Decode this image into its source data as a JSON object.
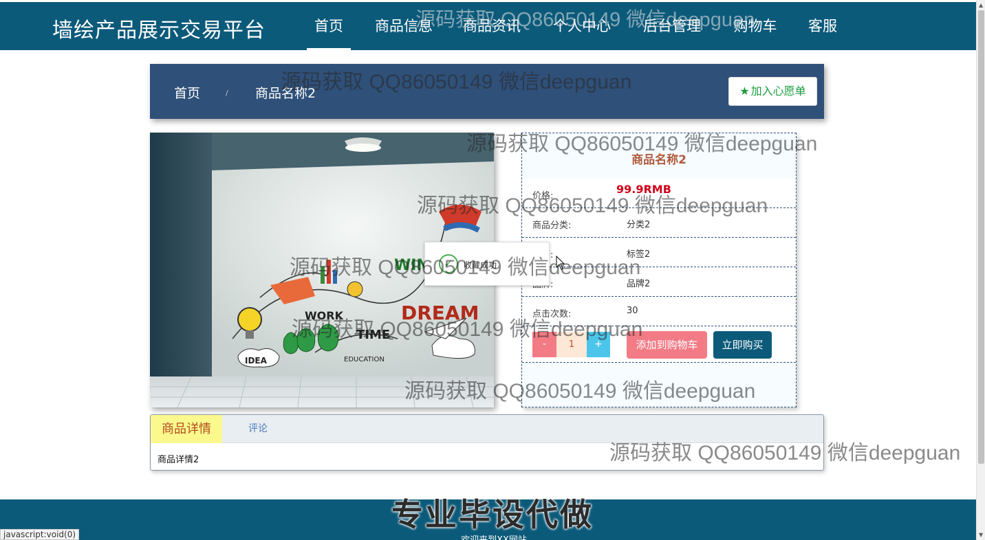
{
  "brand": "墙绘产品展示交易平台",
  "nav": [
    {
      "label": "首页",
      "active": true
    },
    {
      "label": "商品信息"
    },
    {
      "label": "商品资讯"
    },
    {
      "label": "个人中心"
    },
    {
      "label": "后台管理"
    },
    {
      "label": "购物车"
    },
    {
      "label": "客服"
    }
  ],
  "breadcrumb": {
    "home": "首页",
    "separator": "/",
    "current": "商品名称2"
  },
  "wishlist_label": "加入心愿单",
  "product": {
    "name": "商品名称2",
    "price_label": "价格:",
    "price": "99.9RMB",
    "category_label": "商品分类:",
    "category": "分类2",
    "tag_label": "标签:",
    "tag": "标签2",
    "brand_label": "品牌:",
    "brand": "品牌2",
    "clicks_label": "点击次数:",
    "clicks": "30",
    "qty_minus": "-",
    "qty_value": "1",
    "qty_plus": "+",
    "add_to_cart": "添加到购物车",
    "buy_now": "立即购买"
  },
  "toast": "收藏成功",
  "tabs": {
    "detail": "商品详情",
    "comment": "评论",
    "detail_body": "商品详情2"
  },
  "footer": {
    "slogan": "专业毕设代做",
    "welcome": "欢迎来到XX网站"
  },
  "status_bar": "javascript:void(0)",
  "watermark": "源码获取 QQ86050149 微信deepguan",
  "colors": {
    "nav_bg": "#0c5a7a",
    "breadcrumb_bg": "#2f5079",
    "price": "#d0021b",
    "cart_button": "#f27b86",
    "buy_button": "#0c5a7a",
    "active_tab": "#fbf98d"
  }
}
